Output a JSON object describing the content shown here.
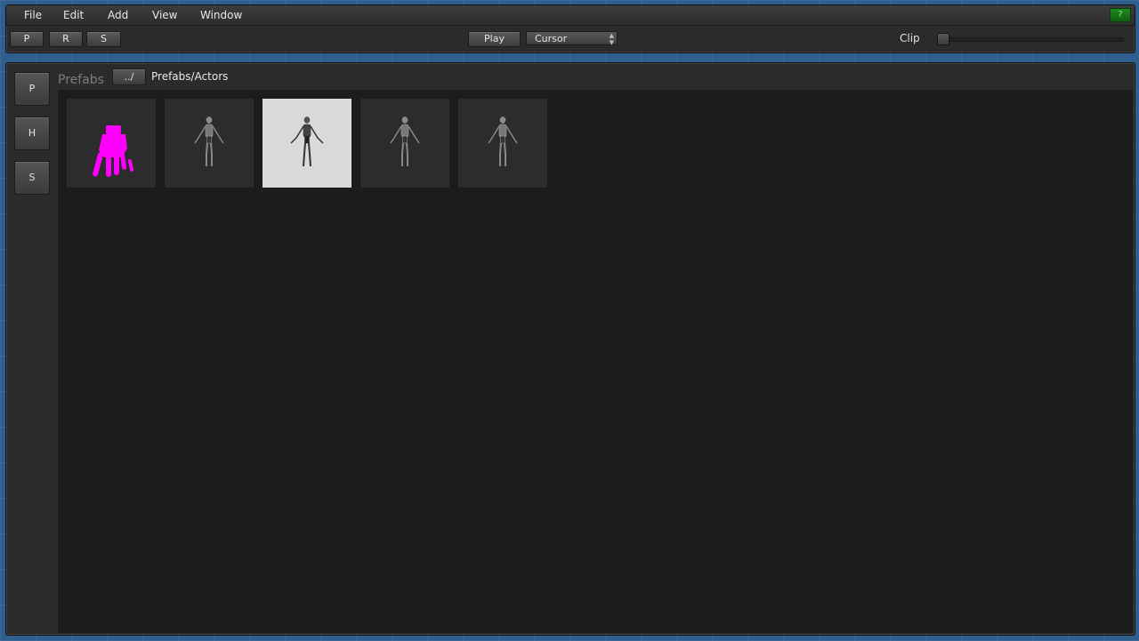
{
  "menu": {
    "file": "File",
    "edit": "Edit",
    "add": "Add",
    "view": "View",
    "window": "Window",
    "help": "?"
  },
  "toolbar": {
    "p": "P",
    "r": "R",
    "s": "S",
    "play": "Play",
    "mode_select": "Cursor",
    "clip_label": "Clip",
    "clip_value": 0
  },
  "sidebar": {
    "p": "P",
    "h": "H",
    "s": "S"
  },
  "browser": {
    "title": "Prefabs",
    "up_button": "../",
    "path": "Prefabs/Actors",
    "items": [
      {
        "icon": "hand-icon",
        "selected": false
      },
      {
        "icon": "robot-figure-icon",
        "selected": false
      },
      {
        "icon": "robot-figure-icon",
        "selected": true
      },
      {
        "icon": "robot-figure-icon",
        "selected": false
      },
      {
        "icon": "robot-figure-icon",
        "selected": false
      }
    ]
  },
  "colors": {
    "accent_magenta": "#ff00ff",
    "help_green": "#1f8a1f",
    "selected_tile": "#d9d9d9"
  }
}
